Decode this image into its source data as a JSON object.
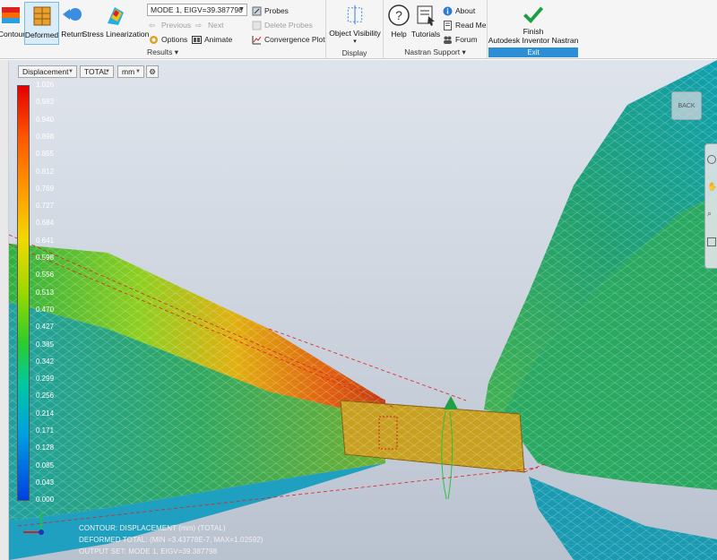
{
  "ribbon": {
    "results_panel": {
      "label": "Results",
      "buttons": [
        "Contour",
        "Deformed",
        "Return",
        "Stress Linearization"
      ],
      "mode_select": "MODE 1, EIGV=39.387798",
      "previous": "Previous",
      "next": "Next",
      "options": "Options",
      "animate": "Animate",
      "probes": "Probes",
      "delete_probes": "Delete Probes",
      "convergence_plot": "Convergence Plot"
    },
    "display_panel": {
      "label": "Display",
      "object_visibility": "Object Visibility"
    },
    "support_panel": {
      "label": "Nastran Support",
      "help": "Help",
      "tutorials": "Tutorials",
      "about": "About",
      "read_me": "Read Me",
      "forum": "Forum"
    },
    "exit_panel": {
      "label": "Exit",
      "finish_line1": "Finish",
      "finish_line2": "Autodesk Inventor Nastran"
    }
  },
  "viewport": {
    "toolbar": {
      "result_type": "Displacement",
      "component": "TOTAL",
      "units": "mm"
    },
    "legend_values": [
      "1.026",
      "0.983",
      "0.940",
      "0.898",
      "0.855",
      "0.812",
      "0.769",
      "0.727",
      "0.684",
      "0.641",
      "0.598",
      "0.556",
      "0.513",
      "0.470",
      "0.427",
      "0.385",
      "0.342",
      "0.299",
      "0.256",
      "0.214",
      "0.171",
      "0.128",
      "0.085",
      "0.043",
      "0.000"
    ],
    "footer": {
      "line1": "CONTOUR: DISPLACEMENT (mm) (TOTAL)",
      "line2": "DEFORMED TOTAL: (MIN    =3.43778E-7, MAX=1.02592)",
      "line3": "OUTPUT SET: MODE 1, EIGV=39.387798"
    },
    "back_label": "BACK"
  }
}
